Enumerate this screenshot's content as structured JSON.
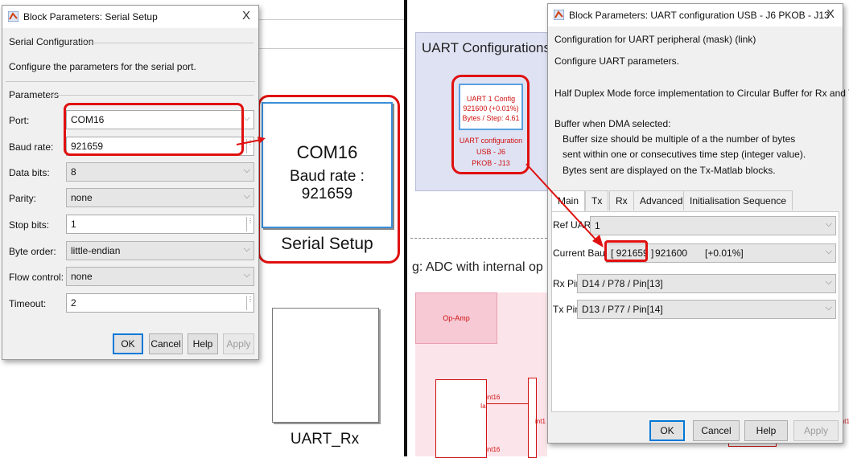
{
  "left_dialog": {
    "title": "Block Parameters: Serial Setup",
    "close": "X",
    "group_title": "Serial Configuration",
    "description": "Configure the parameters for the serial port.",
    "params_title": "Parameters",
    "rows": [
      {
        "label": "Port:",
        "value": "COM16"
      },
      {
        "label": "Baud rate:",
        "value": "921659"
      },
      {
        "label": "Data bits:",
        "value": "8"
      },
      {
        "label": "Parity:",
        "value": "none"
      },
      {
        "label": "Stop bits:",
        "value": "1"
      },
      {
        "label": "Byte order:",
        "value": "little-endian"
      },
      {
        "label": "Flow control:",
        "value": "none"
      },
      {
        "label": "Timeout:",
        "value": "2"
      }
    ],
    "buttons": {
      "ok": "OK",
      "cancel": "Cancel",
      "help": "Help",
      "apply": "Apply"
    }
  },
  "serial_block": {
    "line1": "COM16",
    "line2": "Baud rate : 921659",
    "caption": "Serial Setup"
  },
  "uart_rx_block": {
    "caption": "UART_Rx"
  },
  "right_canvas": {
    "uart_configurations_title": "UART Configurations",
    "uart_block": {
      "line1": "UART 1 Config",
      "line2": "921600 (+0.01%)",
      "line3": "Bytes / Step:  4.61"
    },
    "uart_block_label": [
      "UART configuration",
      "USB - J6",
      "PKOB - J13"
    ],
    "adc_title": "g: ADC with internal op am",
    "opamp_label": "Op-Amp",
    "signal_labels": {
      "int16_a": "int16",
      "ia": "Ia",
      "int1": "int1",
      "int16_b": "int16",
      "int16_c": "int16"
    }
  },
  "right_dialog": {
    "title": "Block Parameters: UART configuration USB - J6 PKOB - J13",
    "close": "X",
    "mask_title": "Configuration for UART peripheral (mask) (link)",
    "desc1": "Configure UART parameters.",
    "desc2": "Half Duplex Mode force implementation to Circular Buffer for Rx and Tx.",
    "desc3": "Buffer when DMA selected:",
    "desc4": "Buffer size should be multiple of a the number of bytes",
    "desc5": "sent within one or consecutives time step (integer value).",
    "desc6": "Bytes sent are displayed on the Tx-Matlab blocks.",
    "tabs": [
      "Main",
      "Tx",
      "Rx",
      "Advanced",
      "Initialisation Sequence"
    ],
    "ref_uart": {
      "label": "Ref UART",
      "value": "1"
    },
    "current_baud": {
      "label": "Current Baud:",
      "value": "[ 921659 ]",
      "target": "921600",
      "error": "[+0.01%]"
    },
    "rx_pin": {
      "label": "Rx Pin",
      "value": "D14 / P78 / Pin[13]"
    },
    "tx_pin": {
      "label": "Tx Pin",
      "value": "D13 / P77 / Pin[14]"
    },
    "buttons": {
      "ok": "OK",
      "cancel": "Cancel",
      "help": "Help",
      "apply": "Apply"
    }
  },
  "colors": {
    "highlight": "#e01010",
    "accent": "#0078d7",
    "block_red": "#d01010"
  }
}
